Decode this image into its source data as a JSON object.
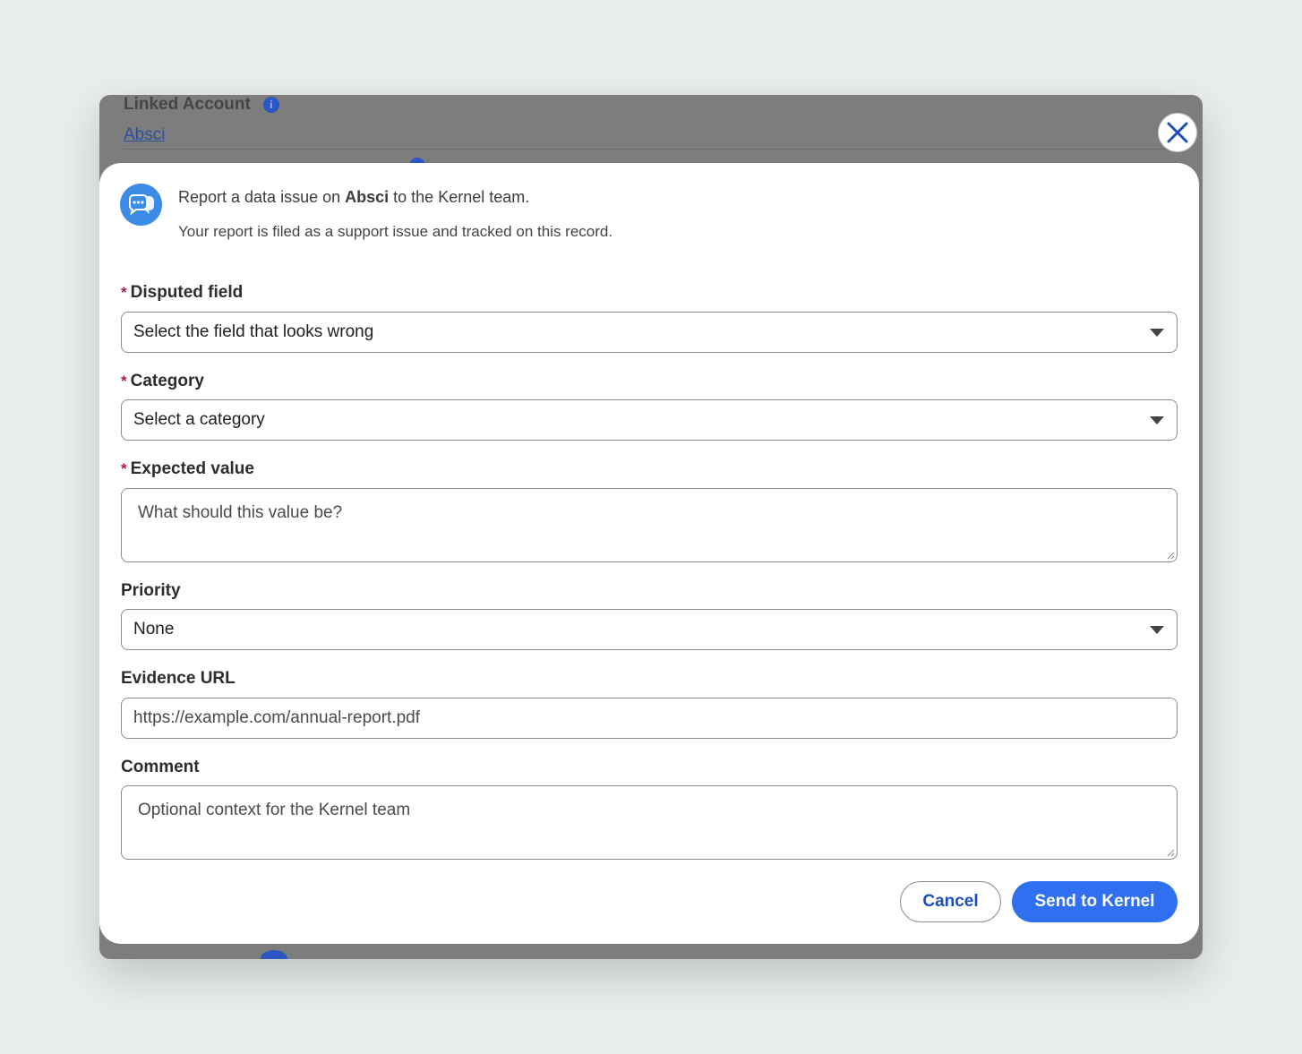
{
  "background": {
    "linked_account_label": "Linked Account",
    "linked_account_value": "Absci",
    "info_icon_glyph": "i"
  },
  "dialog": {
    "title_prefix": "Report a data issue on ",
    "title_entity": "Absci",
    "title_suffix": " to the Kernel team.",
    "subtitle": "Your report is filed as a support issue and tracked on this record.",
    "header_icon": "chat-bubbles-icon",
    "close_icon": "close-icon"
  },
  "form": {
    "required_marker": "*",
    "disputed_field": {
      "label": "Disputed field",
      "value": "Select the field that looks wrong",
      "required": true
    },
    "category": {
      "label": "Category",
      "value": "Select a category",
      "required": true
    },
    "expected_value": {
      "label": "Expected value",
      "placeholder": "What should this value be?",
      "required": true
    },
    "priority": {
      "label": "Priority",
      "value": "None",
      "required": false
    },
    "evidence_url": {
      "label": "Evidence URL",
      "placeholder": "https://example.com/annual-report.pdf",
      "required": false
    },
    "comment": {
      "label": "Comment",
      "placeholder": "Optional context for the Kernel team",
      "required": false
    }
  },
  "actions": {
    "cancel_label": "Cancel",
    "submit_label": "Send to Kernel"
  },
  "colors": {
    "accent": "#2f6ff0",
    "link": "#1b4fc0",
    "required": "#b0174a",
    "icon_bg": "#3c8be6"
  }
}
